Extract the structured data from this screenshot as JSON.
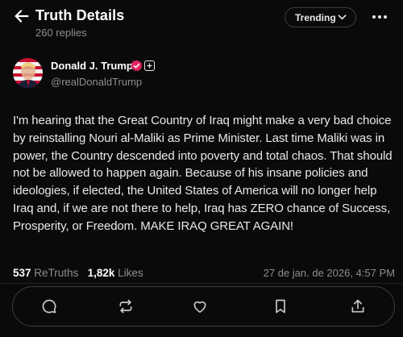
{
  "header": {
    "title": "Truth Details",
    "replies": "260 replies",
    "sort_label": "Trending"
  },
  "author": {
    "name": "Donald J. Trump",
    "handle": "@realDonaldTrump"
  },
  "post": {
    "text": "I'm hearing that the Great Country of Iraq might make a very bad choice by reinstalling Nouri al-Maliki as Prime Minister. Last time Maliki was in power, the Country descended into poverty and total chaos. That should not be allowed to happen again. Because of his insane policies and ideologies, if elected, the United States of America will no longer help Iraq and, if we are not there to help, Iraq has ZERO chance of Success, Prosperity, or Freedom. MAKE IRAQ GREAT AGAIN!"
  },
  "stats": {
    "retruths_count": "537",
    "retruths_label": "ReTruths",
    "likes_count": "1,82k",
    "likes_label": "Likes",
    "timestamp": "27 de jan. de 2026, 4:57 PM"
  },
  "colors": {
    "background": "#0a0a0a",
    "text": "#e7e9ea",
    "muted": "#8b8f94",
    "verified": "#e0245e",
    "border": "#3a3d41"
  },
  "icons": [
    "back-arrow-icon",
    "chevron-down-icon",
    "more-dots-icon",
    "verified-icon",
    "plus-icon",
    "reply-icon",
    "retruth-icon",
    "like-icon",
    "bookmark-icon",
    "share-icon"
  ]
}
